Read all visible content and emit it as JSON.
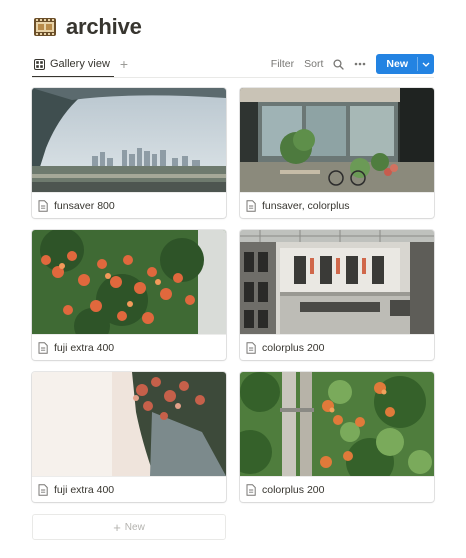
{
  "page": {
    "title": "archive",
    "icon": "film-icon"
  },
  "toolbar": {
    "view_label": "Gallery view",
    "add_view": "+",
    "filter_label": "Filter",
    "sort_label": "Sort",
    "search_icon": "search-icon",
    "more_icon": "more-icon",
    "new_label": "New",
    "accent_color": "#2383e2"
  },
  "cards": [
    {
      "title": "funsaver 800",
      "cover": "city skyline from train window"
    },
    {
      "title": "funsaver, colorplus",
      "cover": "storefront with plants and bicycle"
    },
    {
      "title": "fuji extra 400",
      "cover": "orange trumpet flowers on vine"
    },
    {
      "title": "colorplus 200",
      "cover": "atrium building interior"
    },
    {
      "title": "fuji extra 400",
      "cover": "overexposed flowers on white"
    },
    {
      "title": "colorplus 200",
      "cover": "ivy with orange flowers on pole"
    }
  ],
  "footer": {
    "new_row_plus": "+",
    "new_row_label": "New"
  }
}
